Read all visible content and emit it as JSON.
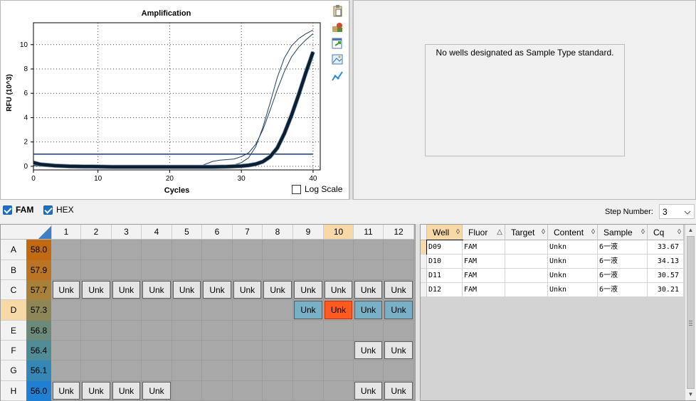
{
  "chart_data": {
    "type": "line",
    "title": "Amplification",
    "xlabel": "Cycles",
    "ylabel": "RFU (10^3)",
    "xlim": [
      1,
      41
    ],
    "ylim": [
      -0.3,
      11.8
    ],
    "xticks": [
      0,
      10,
      20,
      30,
      40
    ],
    "yticks": [
      0,
      2,
      4,
      6,
      8,
      10
    ],
    "grid": true,
    "threshold": 1.0,
    "series": [
      {
        "x": [
          1,
          2,
          4,
          6,
          8,
          10,
          12,
          14,
          16,
          18,
          20,
          22,
          24,
          26,
          27,
          28,
          29,
          30,
          31,
          32,
          33,
          34,
          35,
          36,
          37,
          38,
          39,
          40
        ],
        "y": [
          0.05,
          0.0,
          -0.05,
          -0.05,
          -0.05,
          -0.05,
          -0.05,
          -0.05,
          -0.05,
          -0.05,
          -0.05,
          -0.05,
          0.0,
          0.0,
          0.02,
          0.05,
          0.12,
          0.3,
          0.7,
          1.6,
          3.2,
          5.2,
          7.3,
          8.9,
          9.9,
          10.5,
          10.9,
          11.2
        ],
        "color": "#1e3f66",
        "width": 1
      },
      {
        "x": [
          1,
          2,
          4,
          6,
          8,
          10,
          12,
          14,
          16,
          18,
          20,
          22,
          24,
          26,
          27,
          28,
          29,
          30,
          31,
          32,
          33,
          34,
          35,
          36,
          37,
          38,
          39,
          40
        ],
        "y": [
          0.1,
          0.02,
          -0.05,
          -0.05,
          -0.05,
          -0.05,
          -0.05,
          -0.05,
          -0.05,
          -0.05,
          -0.05,
          -0.05,
          -0.05,
          0.4,
          0.5,
          0.55,
          0.6,
          0.8,
          1.1,
          1.8,
          3.0,
          4.6,
          6.3,
          7.8,
          9.0,
          9.8,
          10.4,
          10.9
        ],
        "color": "#1e3f66",
        "width": 1
      },
      {
        "x": [
          1,
          2,
          4,
          6,
          8,
          10,
          12,
          14,
          16,
          18,
          20,
          22,
          24,
          26,
          28,
          30,
          31,
          32,
          33,
          34,
          35,
          36,
          37,
          38,
          39,
          40
        ],
        "y": [
          0.35,
          0.2,
          0.1,
          0.05,
          0.03,
          0.0,
          0.0,
          -0.02,
          0.0,
          0.0,
          0.0,
          0.0,
          0.0,
          0.0,
          0.0,
          0.05,
          0.1,
          0.2,
          0.4,
          0.8,
          1.5,
          2.6,
          4.0,
          5.7,
          7.5,
          9.1
        ],
        "color": "#1e3f66",
        "width": 1.2
      },
      {
        "x": [
          1,
          2,
          4,
          6,
          8,
          10,
          12,
          14,
          16,
          18,
          20,
          22,
          24,
          26,
          28,
          30,
          31,
          32,
          33,
          34,
          35,
          36,
          37,
          38,
          39,
          40
        ],
        "y": [
          0.3,
          0.15,
          0.05,
          0.0,
          -0.02,
          -0.03,
          -0.05,
          -0.05,
          -0.05,
          -0.05,
          -0.05,
          -0.05,
          -0.05,
          -0.05,
          -0.03,
          0.02,
          0.08,
          0.18,
          0.38,
          0.78,
          1.5,
          2.7,
          4.2,
          5.9,
          7.7,
          9.4
        ],
        "color": "#0d1f33",
        "width": 4.5
      }
    ]
  },
  "toolbar": {
    "icons": [
      "clipboard-icon",
      "settings-icon",
      "export-icon",
      "image-icon",
      "chart-line-icon"
    ]
  },
  "log_scale_label": "Log Scale",
  "standard_message": "No wells designated as Sample Type standard.",
  "fluors": [
    {
      "label": "FAM",
      "checked": true
    },
    {
      "label": "HEX",
      "checked": true
    }
  ],
  "step_number": {
    "label": "Step Number:",
    "value": "3"
  },
  "plate": {
    "columns": [
      "1",
      "2",
      "3",
      "4",
      "5",
      "6",
      "7",
      "8",
      "9",
      "10",
      "11",
      "12"
    ],
    "selected_column": "10",
    "selected_row": "D",
    "rows": [
      {
        "label": "A",
        "temp": "58.0",
        "temp_color": "#c26a12",
        "wells": [
          "",
          "",
          "",
          "",
          "",
          "",
          "",
          "",
          "",
          "",
          "",
          ""
        ]
      },
      {
        "label": "B",
        "temp": "57.9",
        "temp_color": "#bb7424",
        "wells": [
          "",
          "",
          "",
          "",
          "",
          "",
          "",
          "",
          "",
          "",
          "",
          ""
        ]
      },
      {
        "label": "C",
        "temp": "57.7",
        "temp_color": "#a8803a",
        "wells": [
          "Unk",
          "Unk",
          "Unk",
          "Unk",
          "Unk",
          "Unk",
          "Unk",
          "Unk",
          "Unk",
          "Unk",
          "Unk",
          "Unk"
        ]
      },
      {
        "label": "D",
        "temp": "57.3",
        "temp_color": "#8f8657",
        "wells": [
          "",
          "",
          "",
          "",
          "",
          "",
          "",
          "",
          "Unk",
          "Unk",
          "Unk",
          "Unk"
        ],
        "well_styles": [
          "",
          "",
          "",
          "",
          "",
          "",
          "",
          "",
          "blue",
          "orange",
          "blue",
          "blue"
        ]
      },
      {
        "label": "E",
        "temp": "56.8",
        "temp_color": "#6b8a79",
        "wells": [
          "",
          "",
          "",
          "",
          "",
          "",
          "",
          "",
          "",
          "",
          "",
          ""
        ]
      },
      {
        "label": "F",
        "temp": "56.4",
        "temp_color": "#4f8c96",
        "wells": [
          "",
          "",
          "",
          "",
          "",
          "",
          "",
          "",
          "",
          "",
          "Unk",
          "Unk"
        ]
      },
      {
        "label": "G",
        "temp": "56.1",
        "temp_color": "#3587b6",
        "wells": [
          "",
          "",
          "",
          "",
          "",
          "",
          "",
          "",
          "",
          "",
          "",
          ""
        ]
      },
      {
        "label": "H",
        "temp": "56.0",
        "temp_color": "#1f7fd2",
        "wells": [
          "Unk",
          "Unk",
          "Unk",
          "Unk",
          "",
          "",
          "",
          "",
          "",
          "",
          "Unk",
          "Unk"
        ]
      }
    ]
  },
  "table": {
    "headers": [
      "Well",
      "Fluor",
      "Target",
      "Content",
      "Sample",
      "Cq"
    ],
    "sort_glyphs": [
      "◊",
      "△",
      "◊",
      "◊",
      "◊",
      "◊"
    ],
    "rows": [
      {
        "well": "D09",
        "fluor": "FAM",
        "target": "",
        "content": "Unkn",
        "sample": "6一液",
        "cq": "33.67"
      },
      {
        "well": "D10",
        "fluor": "FAM",
        "target": "",
        "content": "Unkn",
        "sample": "6一液",
        "cq": "34.13"
      },
      {
        "well": "D11",
        "fluor": "FAM",
        "target": "",
        "content": "Unkn",
        "sample": "6一液",
        "cq": "30.57"
      },
      {
        "well": "D12",
        "fluor": "FAM",
        "target": "",
        "content": "Unkn",
        "sample": "6一液",
        "cq": "30.21"
      }
    ]
  }
}
